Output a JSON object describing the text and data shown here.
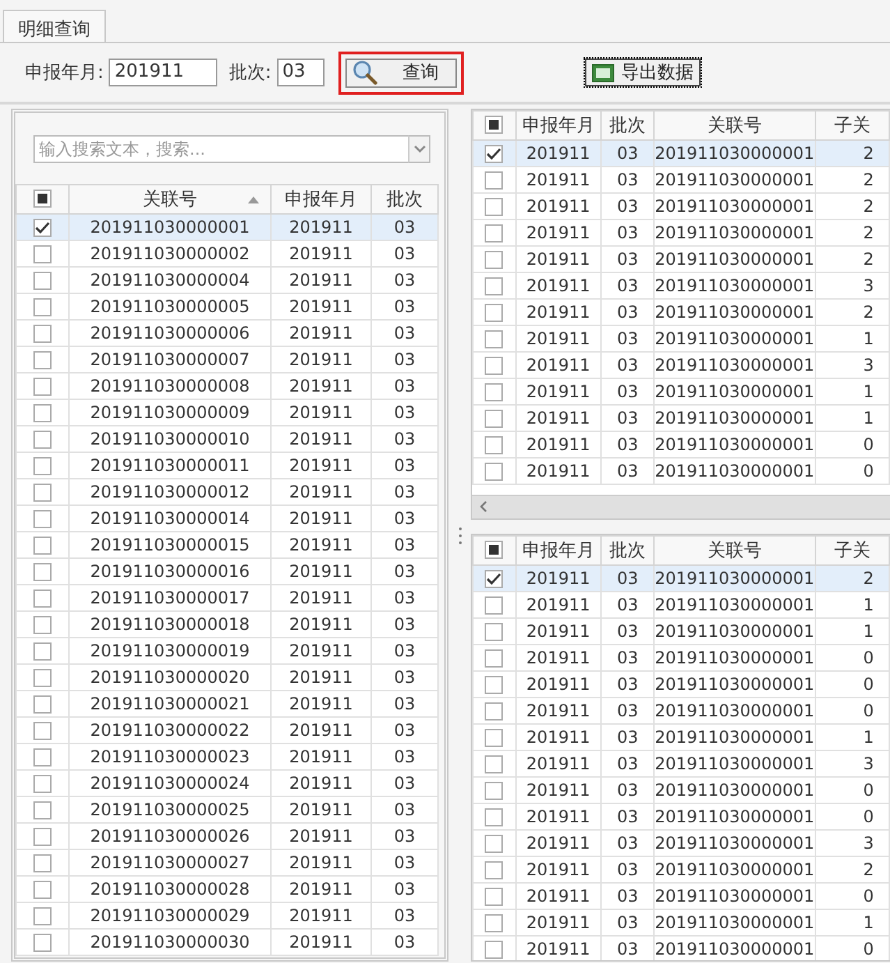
{
  "tab": {
    "label": "明细查询",
    "selected": true
  },
  "filters": [
    {
      "label": "申报年月:",
      "value": "201911",
      "kind": "wide"
    },
    {
      "label": "批次:",
      "value": "03",
      "kind": "narrow"
    }
  ],
  "query_button": {
    "label": "查询",
    "highlighted": true
  },
  "export_button": {
    "label": "导出数据"
  },
  "left_table": {
    "search": {
      "placeholder": "输入搜索文本，搜索..."
    },
    "header_checkbox": {
      "indeterminate": true
    },
    "columns": [
      {
        "label": "关联号",
        "sorted": true
      },
      {
        "label": "申报年月",
        "sorted": false
      },
      {
        "label": "批次",
        "sorted": false
      }
    ],
    "rows": [
      {
        "checked": true,
        "selected": true,
        "cells": [
          "201911030000001",
          "201911",
          "03"
        ]
      },
      {
        "checked": false,
        "selected": false,
        "cells": [
          "201911030000002",
          "201911",
          "03"
        ]
      },
      {
        "checked": false,
        "selected": false,
        "cells": [
          "201911030000004",
          "201911",
          "03"
        ]
      },
      {
        "checked": false,
        "selected": false,
        "cells": [
          "201911030000005",
          "201911",
          "03"
        ]
      },
      {
        "checked": false,
        "selected": false,
        "cells": [
          "201911030000006",
          "201911",
          "03"
        ]
      },
      {
        "checked": false,
        "selected": false,
        "cells": [
          "201911030000007",
          "201911",
          "03"
        ]
      },
      {
        "checked": false,
        "selected": false,
        "cells": [
          "201911030000008",
          "201911",
          "03"
        ]
      },
      {
        "checked": false,
        "selected": false,
        "cells": [
          "201911030000009",
          "201911",
          "03"
        ]
      },
      {
        "checked": false,
        "selected": false,
        "cells": [
          "201911030000010",
          "201911",
          "03"
        ]
      },
      {
        "checked": false,
        "selected": false,
        "cells": [
          "201911030000011",
          "201911",
          "03"
        ]
      },
      {
        "checked": false,
        "selected": false,
        "cells": [
          "201911030000012",
          "201911",
          "03"
        ]
      },
      {
        "checked": false,
        "selected": false,
        "cells": [
          "201911030000014",
          "201911",
          "03"
        ]
      },
      {
        "checked": false,
        "selected": false,
        "cells": [
          "201911030000015",
          "201911",
          "03"
        ]
      },
      {
        "checked": false,
        "selected": false,
        "cells": [
          "201911030000016",
          "201911",
          "03"
        ]
      },
      {
        "checked": false,
        "selected": false,
        "cells": [
          "201911030000017",
          "201911",
          "03"
        ]
      },
      {
        "checked": false,
        "selected": false,
        "cells": [
          "201911030000018",
          "201911",
          "03"
        ]
      },
      {
        "checked": false,
        "selected": false,
        "cells": [
          "201911030000019",
          "201911",
          "03"
        ]
      },
      {
        "checked": false,
        "selected": false,
        "cells": [
          "201911030000020",
          "201911",
          "03"
        ]
      },
      {
        "checked": false,
        "selected": false,
        "cells": [
          "201911030000021",
          "201911",
          "03"
        ]
      },
      {
        "checked": false,
        "selected": false,
        "cells": [
          "201911030000022",
          "201911",
          "03"
        ]
      },
      {
        "checked": false,
        "selected": false,
        "cells": [
          "201911030000023",
          "201911",
          "03"
        ]
      },
      {
        "checked": false,
        "selected": false,
        "cells": [
          "201911030000024",
          "201911",
          "03"
        ]
      },
      {
        "checked": false,
        "selected": false,
        "cells": [
          "201911030000025",
          "201911",
          "03"
        ]
      },
      {
        "checked": false,
        "selected": false,
        "cells": [
          "201911030000026",
          "201911",
          "03"
        ]
      },
      {
        "checked": false,
        "selected": false,
        "cells": [
          "201911030000027",
          "201911",
          "03"
        ]
      },
      {
        "checked": false,
        "selected": false,
        "cells": [
          "201911030000028",
          "201911",
          "03"
        ]
      },
      {
        "checked": false,
        "selected": false,
        "cells": [
          "201911030000029",
          "201911",
          "03"
        ]
      },
      {
        "checked": false,
        "selected": false,
        "cells": [
          "201911030000030",
          "201911",
          "03"
        ]
      }
    ]
  },
  "detail_tables": [
    {
      "header_checkbox": {
        "indeterminate": true
      },
      "has_scrollbar": true,
      "columns": [
        {
          "label": "申报年月"
        },
        {
          "label": "批次"
        },
        {
          "label": "关联号"
        },
        {
          "label": "子关"
        }
      ],
      "rows": [
        {
          "checked": true,
          "selected": true,
          "cells": [
            "201911",
            "03",
            "201911030000001",
            "2"
          ]
        },
        {
          "checked": false,
          "selected": false,
          "cells": [
            "201911",
            "03",
            "201911030000001",
            "2"
          ]
        },
        {
          "checked": false,
          "selected": false,
          "cells": [
            "201911",
            "03",
            "201911030000001",
            "2"
          ]
        },
        {
          "checked": false,
          "selected": false,
          "cells": [
            "201911",
            "03",
            "201911030000001",
            "2"
          ]
        },
        {
          "checked": false,
          "selected": false,
          "cells": [
            "201911",
            "03",
            "201911030000001",
            "2"
          ]
        },
        {
          "checked": false,
          "selected": false,
          "cells": [
            "201911",
            "03",
            "201911030000001",
            "3"
          ]
        },
        {
          "checked": false,
          "selected": false,
          "cells": [
            "201911",
            "03",
            "201911030000001",
            "2"
          ]
        },
        {
          "checked": false,
          "selected": false,
          "cells": [
            "201911",
            "03",
            "201911030000001",
            "1"
          ]
        },
        {
          "checked": false,
          "selected": false,
          "cells": [
            "201911",
            "03",
            "201911030000001",
            "3"
          ]
        },
        {
          "checked": false,
          "selected": false,
          "cells": [
            "201911",
            "03",
            "201911030000001",
            "1"
          ]
        },
        {
          "checked": false,
          "selected": false,
          "cells": [
            "201911",
            "03",
            "201911030000001",
            "1"
          ]
        },
        {
          "checked": false,
          "selected": false,
          "cells": [
            "201911",
            "03",
            "201911030000001",
            "0"
          ]
        },
        {
          "checked": false,
          "selected": false,
          "cells": [
            "201911",
            "03",
            "201911030000001",
            "0"
          ]
        }
      ]
    },
    {
      "header_checkbox": {
        "indeterminate": true
      },
      "has_scrollbar": false,
      "columns": [
        {
          "label": "申报年月"
        },
        {
          "label": "批次"
        },
        {
          "label": "关联号"
        },
        {
          "label": "子关"
        }
      ],
      "rows": [
        {
          "checked": true,
          "selected": true,
          "cells": [
            "201911",
            "03",
            "201911030000001",
            "2"
          ]
        },
        {
          "checked": false,
          "selected": false,
          "cells": [
            "201911",
            "03",
            "201911030000001",
            "1"
          ]
        },
        {
          "checked": false,
          "selected": false,
          "cells": [
            "201911",
            "03",
            "201911030000001",
            "1"
          ]
        },
        {
          "checked": false,
          "selected": false,
          "cells": [
            "201911",
            "03",
            "201911030000001",
            "0"
          ]
        },
        {
          "checked": false,
          "selected": false,
          "cells": [
            "201911",
            "03",
            "201911030000001",
            "0"
          ]
        },
        {
          "checked": false,
          "selected": false,
          "cells": [
            "201911",
            "03",
            "201911030000001",
            "0"
          ]
        },
        {
          "checked": false,
          "selected": false,
          "cells": [
            "201911",
            "03",
            "201911030000001",
            "1"
          ]
        },
        {
          "checked": false,
          "selected": false,
          "cells": [
            "201911",
            "03",
            "201911030000001",
            "3"
          ]
        },
        {
          "checked": false,
          "selected": false,
          "cells": [
            "201911",
            "03",
            "201911030000001",
            "0"
          ]
        },
        {
          "checked": false,
          "selected": false,
          "cells": [
            "201911",
            "03",
            "201911030000001",
            "0"
          ]
        },
        {
          "checked": false,
          "selected": false,
          "cells": [
            "201911",
            "03",
            "201911030000001",
            "3"
          ]
        },
        {
          "checked": false,
          "selected": false,
          "cells": [
            "201911",
            "03",
            "201911030000001",
            "2"
          ]
        },
        {
          "checked": false,
          "selected": false,
          "cells": [
            "201911",
            "03",
            "201911030000001",
            "0"
          ]
        },
        {
          "checked": false,
          "selected": false,
          "cells": [
            "201911",
            "03",
            "201911030000001",
            "1"
          ]
        },
        {
          "checked": false,
          "selected": false,
          "cells": [
            "201911",
            "03",
            "201911030000001",
            "0"
          ]
        }
      ]
    }
  ]
}
